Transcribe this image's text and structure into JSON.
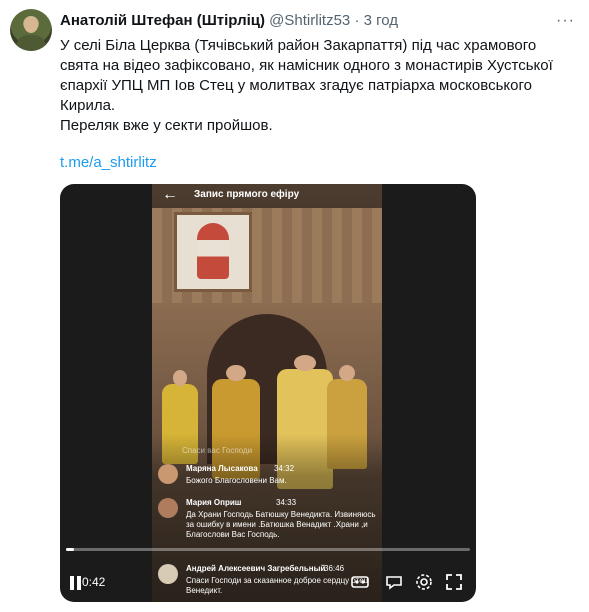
{
  "tweet": {
    "author_name": "Анатолій Штефан (Штірліц)",
    "handle": "@Shtirlitz53",
    "separator": "·",
    "time": "3 год",
    "more_icon": "more-horizontal-icon",
    "text_line1": "У селі Біла Церква (Тячівський район Закарпаття) під час храмового свята на відео зафіксовано, як намісник одного з монастирів Хустської єпархії УПЦ МП Іов Стец у молитвах згадує патріарха московського Кирила.",
    "text_line2": "Переляк вже у секти пройшов.",
    "link": "t.me/a_shtirlitz"
  },
  "video": {
    "live_title": "Запис прямого ефіру",
    "faded_comment": "Спаси вас Господи",
    "comments": [
      {
        "name": "Маряна Лысакова",
        "time": "34:32",
        "text": "Божого Благословени Вам."
      },
      {
        "name": "Мария Оприш",
        "time": "34:33",
        "text": "Да Храни Господь Батюшку Венедикта. Извиняюсь за ошибку в имени .Батюшка Венадикт .Храни ,и Благослови Вас Господь."
      },
      {
        "name": "Андрей Алексеевич Загребельный",
        "time": "36:46",
        "text": "Спаси Господи за сказанное доброе сердцу отец Венедикт."
      }
    ],
    "timecode": "0:42",
    "progress": 0.02,
    "icons": [
      "pause-icon",
      "gif-icon",
      "captions-icon",
      "settings-gear-icon",
      "fullscreen-icon"
    ]
  }
}
